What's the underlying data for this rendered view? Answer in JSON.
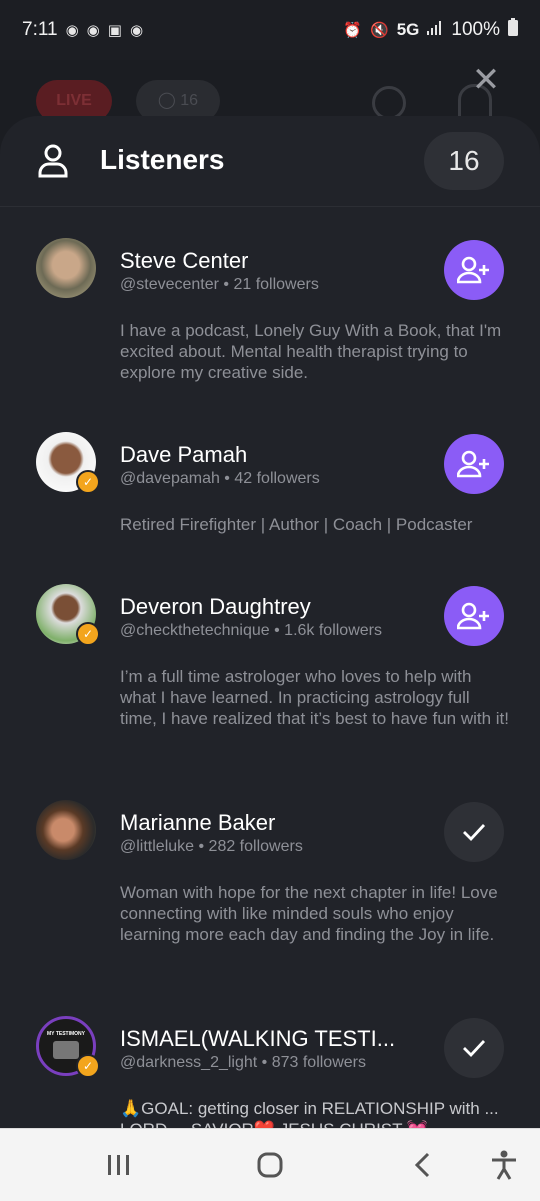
{
  "status_bar": {
    "time": "7:11",
    "network": "5G",
    "battery": "100%",
    "icons": [
      "notification-icon",
      "notification-icon",
      "app-icon",
      "notification-icon",
      "alarm-icon",
      "mute-icon",
      "signal-icon",
      "battery-icon"
    ]
  },
  "background": {
    "live_label": "LIVE",
    "listener_count": "16"
  },
  "sheet": {
    "title": "Listeners",
    "count": "16"
  },
  "listeners": [
    {
      "name": "Steve Center",
      "handle": "@stevecenter • 21 followers",
      "bio": "I have a podcast, Lonely Guy With a Book, that I'm excited about. Mental health therapist trying to explore my creative side.",
      "following": false,
      "verified": false
    },
    {
      "name": "Dave Pamah",
      "handle": "@davepamah • 42 followers",
      "bio": "Retired Firefighter | Author | Coach | Podcaster",
      "following": false,
      "verified": true
    },
    {
      "name": "Deveron Daughtrey",
      "handle": "@checkthetechnique • 1.6k followers",
      "bio": "I’m a full time astrologer who loves to help with what I have learned. In practicing astrology full time, I have realized that it’s best to have fun with it!",
      "following": false,
      "verified": true
    },
    {
      "name": "Marianne Baker",
      "handle": "@littleluke • 282 followers",
      "bio": "Woman with hope for the next chapter in  life! Love connecting with like minded souls who enjoy learning more each day and finding the Joy in life.",
      "following": true,
      "verified": false
    },
    {
      "name": " ISMAEL(WALKING TESTI...",
      "handle": "@darkness_2_light • 873 followers",
      "bio": "🙏GOAL: getting closer in RELATIONSHIP with ... LORD ... SAVIOR❤️ JESUS CHRIST 💓",
      "following": true,
      "verified": true,
      "avatar_caption": "MY TESTIMONY"
    }
  ],
  "colors": {
    "accent": "#8b5cf6",
    "sheet_bg": "#212329",
    "secondary_text": "#8e9097",
    "badge": "#f3a51d"
  }
}
